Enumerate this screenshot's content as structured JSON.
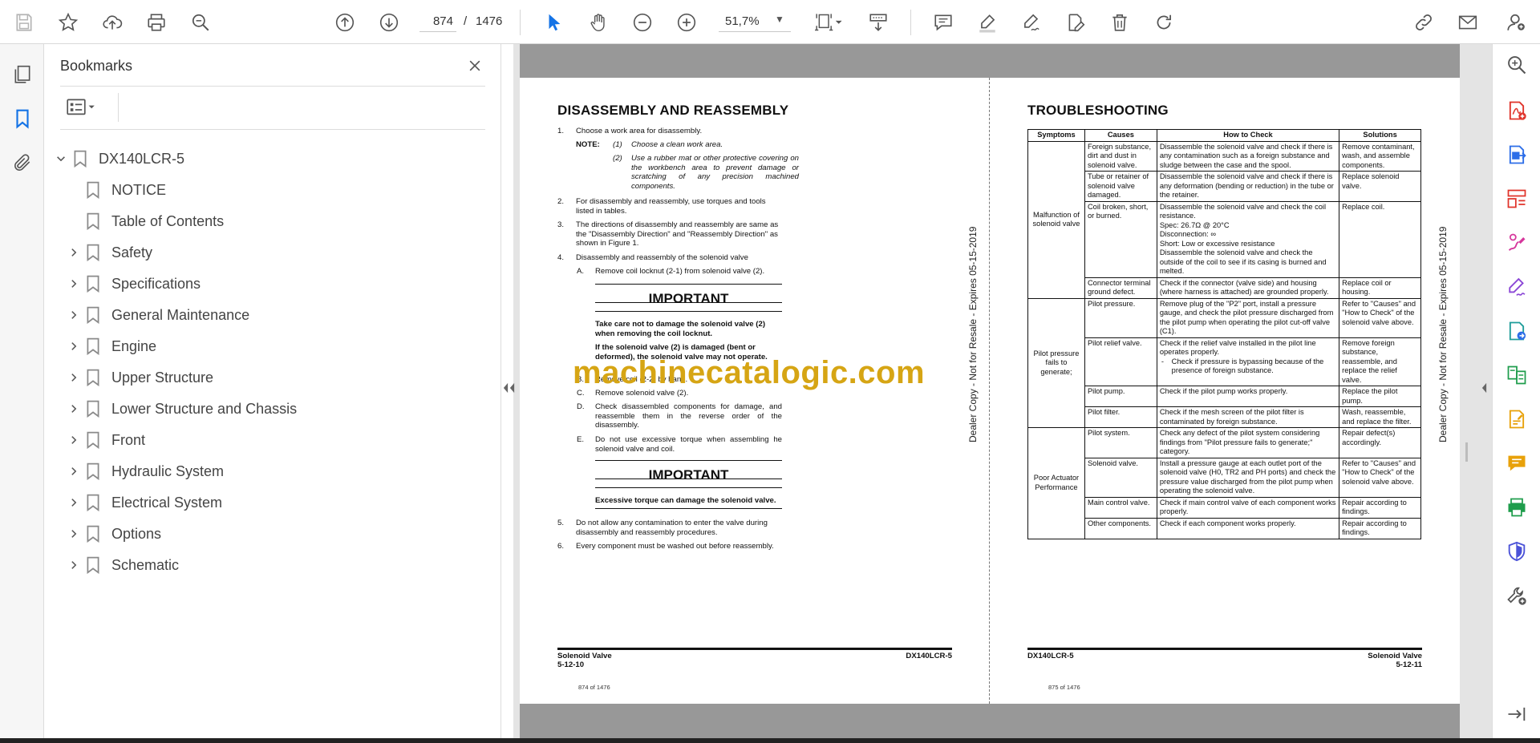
{
  "toolbar": {
    "page_current": "874",
    "page_separator": "/",
    "page_total": "1476",
    "zoom": "51,7%"
  },
  "bookmarks": {
    "title": "Bookmarks",
    "items": [
      {
        "label": "DX140LCR-5",
        "level": 0,
        "expandable": true,
        "expanded": true
      },
      {
        "label": "NOTICE",
        "level": 1,
        "expandable": false
      },
      {
        "label": "Table of Contents",
        "level": 1,
        "expandable": false
      },
      {
        "label": "Safety",
        "level": 1,
        "expandable": true
      },
      {
        "label": "Specifications",
        "level": 1,
        "expandable": true
      },
      {
        "label": "General Maintenance",
        "level": 1,
        "expandable": true
      },
      {
        "label": "Engine",
        "level": 1,
        "expandable": true
      },
      {
        "label": "Upper Structure",
        "level": 1,
        "expandable": true
      },
      {
        "label": "Lower Structure and Chassis",
        "level": 1,
        "expandable": true
      },
      {
        "label": "Front",
        "level": 1,
        "expandable": true
      },
      {
        "label": "Hydraulic System",
        "level": 1,
        "expandable": true
      },
      {
        "label": "Electrical System",
        "level": 1,
        "expandable": true
      },
      {
        "label": "Options",
        "level": 1,
        "expandable": true
      },
      {
        "label": "Schematic",
        "level": 1,
        "expandable": true
      }
    ]
  },
  "left_page": {
    "title": "DISASSEMBLY AND REASSEMBLY",
    "s1_n": "1.",
    "s1": "Choose a work area for disassembly.",
    "note_label": "NOTE:",
    "note1_n": "(1)",
    "note1": "Choose a clean work area.",
    "note2_n": "(2)",
    "note2": "Use a rubber mat or other protective covering on the workbench area to prevent damage or scratching of any precision machined components.",
    "s2_n": "2.",
    "s2": "For disassembly and reassembly, use torques and tools listed in tables.",
    "s3_n": "3.",
    "s3": "The directions of disassembly and reassembly are same as the \"Disassembly Direction\" and \"Reassembly Direction\" as shown in Figure 1.",
    "s4_n": "4.",
    "s4": "Disassembly and reassembly of the solenoid valve",
    "sa_n": "A.",
    "sa": "Remove coil locknut (2-1) from solenoid valve (2).",
    "important1_title": "IMPORTANT",
    "important1_p1": "Take care not to damage the solenoid valve (2) when removing the coil locknut.",
    "important1_p2": "If the solenoid valve (2) is damaged (bent or deformed), the solenoid valve may not operate.",
    "sb_n": "B.",
    "sb": "Remove coil (2-2) by hand.",
    "sc_n": "C.",
    "sc": "Remove solenoid valve (2).",
    "sd_n": "D.",
    "sd": "Check disassembled components for damage, and reassemble them in the reverse order of the disassembly.",
    "se_n": "E.",
    "se": "Do not use excessive torque when assembling he solenoid valve and coil.",
    "important2_title": "IMPORTANT",
    "important2_p1": "Excessive torque can damage the solenoid valve.",
    "s5_n": "5.",
    "s5": "Do not allow any contamination to enter the valve during disassembly and reassembly procedures.",
    "s6_n": "6.",
    "s6": "Every component must be washed out before reassembly.",
    "footer_left_1": "Solenoid Valve",
    "footer_left_2": "5-12-10",
    "footer_right": "DX140LCR-5",
    "page_number": "874 of 1476",
    "side_text": "Dealer Copy - Not for Resale - Expires 05-15-2019"
  },
  "right_page": {
    "title": "TROUBLESHOOTING",
    "headers": [
      "Symptoms",
      "Causes",
      "How to Check",
      "Solutions"
    ],
    "sym1": "Malfunction of solenoid valve",
    "r1_cause": "Foreign substance, dirt and dust in solenoid valve.",
    "r1_check": "Disassemble the solenoid valve and check if there is any contamination such as a foreign substance and sludge between the case and the spool.",
    "r1_sol": "Remove contaminant, wash, and assemble components.",
    "r2_cause": "Tube or retainer of solenoid valve damaged.",
    "r2_check": "Disassemble the solenoid valve and check if there is any deformation (bending or reduction) in the tube or the retainer.",
    "r2_sol": "Replace solenoid valve.",
    "r3_cause": "Coil broken, short, or burned.",
    "r3_check_1": "Disassemble the solenoid valve and check the coil resistance.",
    "r3_check_2": "Spec: 26.7Ω @ 20°C",
    "r3_check_3": "Disconnection: ∞",
    "r3_check_4": "Short: Low or excessive resistance",
    "r3_check_5": "Disassemble the solenoid valve and check the outside of the coil to see if its casing is burned and melted.",
    "r3_sol": "Replace coil.",
    "r4_cause": "Connector terminal ground defect.",
    "r4_check": "Check if the connector (valve side) and housing (where harness is attached) are grounded properly.",
    "r4_sol": "Replace coil or housing.",
    "sym2": "Pilot pressure fails to generate;",
    "r5_cause": "Pilot pressure.",
    "r5_check": "Remove plug of the \"P2\" port, install a pressure gauge, and check the pilot pressure discharged from the pilot pump when operating the pilot cut-off valve (C1).",
    "r5_sol": "Refer to \"Causes\" and \"How to Check\" of the solenoid valve above.",
    "r6_cause": "Pilot relief valve.",
    "r6_check_1": "Check if the relief valve installed in the pilot line operates properly.",
    "r6_check_bullet": "-",
    "r6_check_2": "Check if pressure is bypassing because of the presence of foreign substance.",
    "r6_sol": "Remove foreign substance, reassemble, and replace the relief valve.",
    "r7_cause": "Pilot pump.",
    "r7_check": "Check if the pilot pump works properly.",
    "r7_sol": "Replace the pilot pump.",
    "r8_cause": "Pilot filter.",
    "r8_check": "Check if the mesh screen of the pilot filter is contaminated by foreign substance.",
    "r8_sol": "Wash, reassemble, and replace the filter.",
    "sym3": "Poor Actuator Performance",
    "r9_cause": "Pilot system.",
    "r9_check": "Check any defect of the pilot system considering findings from \"Pilot pressure fails to generate;\" category.",
    "r9_sol": "Repair defect(s) accordingly.",
    "r10_cause": "Solenoid valve.",
    "r10_check": "Install a pressure gauge at each outlet port of the solenoid valve (H0, TR2 and PH ports) and check the pressure value discharged from the pilot pump when operating the solenoid valve.",
    "r10_sol": "Refer to \"Causes\" and \"How to Check\" of the solenoid valve above.",
    "r11_cause": "Main control valve.",
    "r11_check": "Check if main control valve of each component works properly.",
    "r11_sol": "Repair according to findings.",
    "r12_cause": "Other components.",
    "r12_check": "Check if each component works properly.",
    "r12_sol": "Repair according to findings.",
    "footer_left": "DX140LCR-5",
    "footer_right_1": "Solenoid Valve",
    "footer_right_2": "5-12-11",
    "page_number": "875 of 1476",
    "side_text": "Dealer Copy - Not for Resale - Expires 05-15-2019"
  },
  "watermark": "machinecatalogic.com",
  "colors": {
    "accent_blue": "#1473e6",
    "watermark": "#d6a514",
    "rail_red": "#e0332a",
    "rail_blue": "#2d6ee8",
    "rail_pink": "#d6379c",
    "rail_purple": "#8b47d6",
    "rail_green": "#1f9d4c",
    "rail_yellow": "#e8a10a",
    "rail_indigo": "#4b52d8"
  }
}
